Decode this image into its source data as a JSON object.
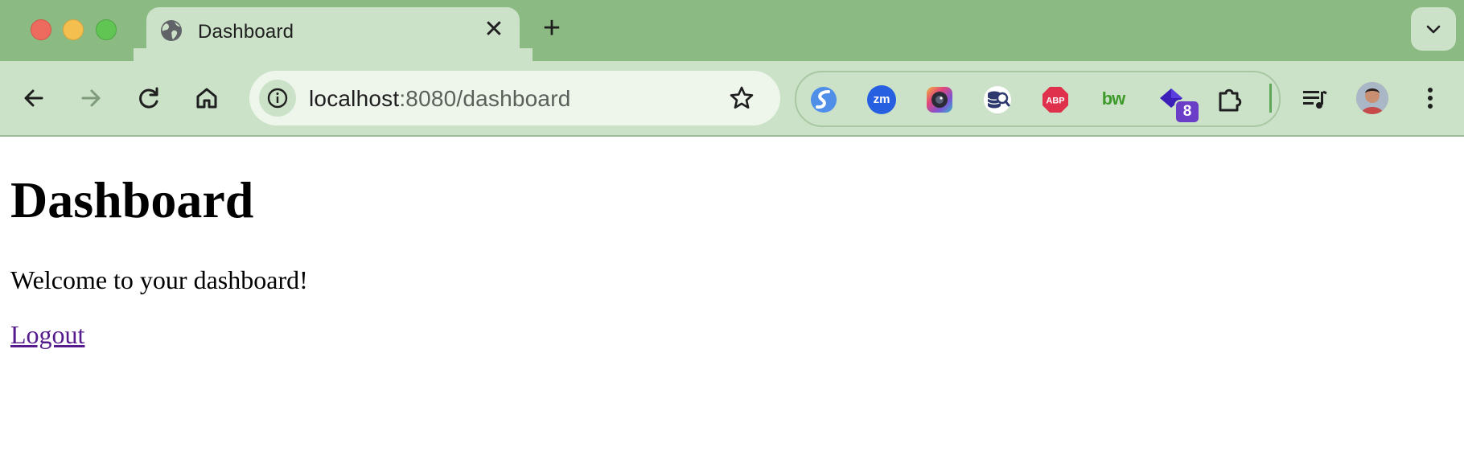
{
  "window": {
    "tab_title": "Dashboard",
    "tab_close_glyph": "✕",
    "new_tab_glyph": "+"
  },
  "toolbar": {
    "url_host": "localhost",
    "url_rest": ":8080/dashboard"
  },
  "extensions": {
    "zoom_label": "zm",
    "abp_label": "ABP",
    "bw_label": "bw",
    "badge_count": "8"
  },
  "page": {
    "heading": "Dashboard",
    "welcome_text": "Welcome to your dashboard!",
    "logout_link": "Logout"
  },
  "colors": {
    "titlebar": "#8bba82",
    "toolbar": "#cbe2c8",
    "link_visited": "#551a8b"
  }
}
